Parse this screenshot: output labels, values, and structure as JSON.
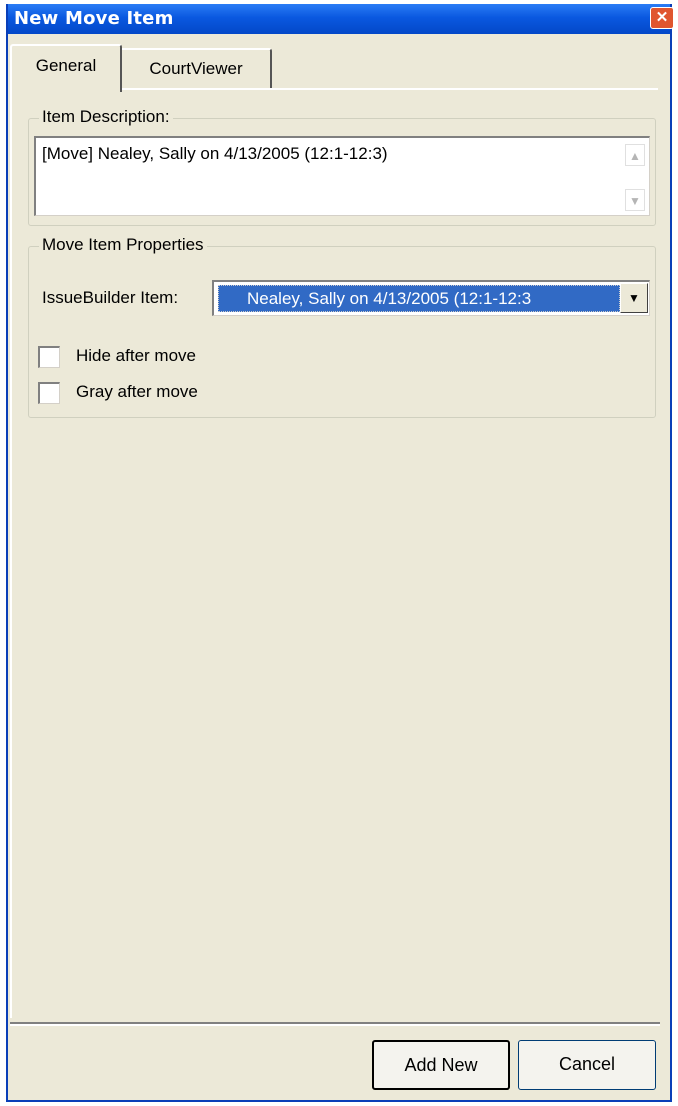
{
  "window": {
    "title": "New Move Item"
  },
  "tabs": [
    {
      "label": "General",
      "active": true
    },
    {
      "label": "CourtViewer",
      "active": false
    }
  ],
  "item_description": {
    "group_label": "Item Description:",
    "value": "[Move] Nealey, Sally on 4/13/2005 (12:1-12:3)"
  },
  "move_properties": {
    "group_label": "Move Item Properties",
    "issuebuilder_label": "IssueBuilder Item:",
    "issuebuilder_value": "Nealey, Sally on 4/13/2005 (12:1-12:3",
    "hide_after_move": {
      "label": "Hide after move",
      "checked": false
    },
    "gray_after_move": {
      "label": "Gray after move",
      "checked": false
    }
  },
  "buttons": {
    "add_new": "Add New",
    "cancel": "Cancel"
  },
  "colors": {
    "titlebar": "#0a58e0",
    "selection": "#316ac5",
    "face": "#ece9d8"
  }
}
